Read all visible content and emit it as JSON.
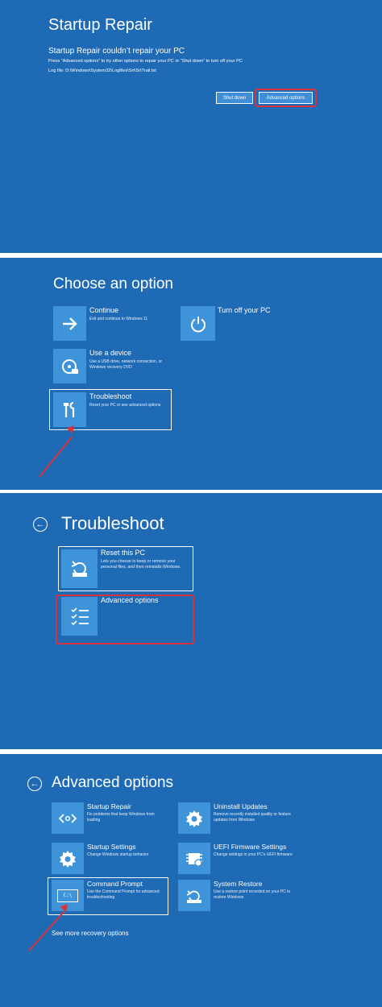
{
  "colors": {
    "background": "#1f6ab5",
    "tile": "#3f93d9",
    "highlight": "#d6343c",
    "separator": "#ffffff"
  },
  "screen1": {
    "title": "Startup Repair",
    "heading": "Startup Repair couldn’t repair your PC",
    "description": "Press “Advanced options” to try other options to repair your PC or “Shut down” to turn off your PC",
    "log_file": "Log file: D:\\Windows\\System32\\Logfiles\\Srt\\SrtTrail.txt",
    "shutdown_label": "Shut down",
    "advanced_label": "Advanced options"
  },
  "screen2": {
    "title": "Choose an option",
    "options": [
      {
        "label": "Continue",
        "desc": "Exit and continue to Windows 11",
        "icon": "arrow-right-icon"
      },
      {
        "label": "Turn off your PC",
        "desc": "",
        "icon": "power-icon"
      },
      {
        "label": "Use a device",
        "desc": "Use a USB drive, network connection, or Windows recovery DVD",
        "icon": "disc-icon"
      },
      {
        "label": "Troubleshoot",
        "desc": "Reset your PC or see advanced options",
        "icon": "tools-icon"
      }
    ]
  },
  "screen3": {
    "title": "Troubleshoot",
    "options": [
      {
        "label": "Reset this PC",
        "desc": "Lets you choose to keep or remove your personal files, and then reinstalls Windows.",
        "icon": "reset-icon"
      },
      {
        "label": "Advanced options",
        "desc": "",
        "icon": "checklist-icon"
      }
    ]
  },
  "screen4": {
    "title": "Advanced options",
    "options": [
      {
        "label": "Startup Repair",
        "desc": "Fix problems that keep Windows from loading",
        "icon": "code-icon"
      },
      {
        "label": "Uninstall Updates",
        "desc": "Remove recently installed quality or feature updates from Windows",
        "icon": "gear-icon"
      },
      {
        "label": "Startup Settings",
        "desc": "Change Windows startup behavior",
        "icon": "gear-icon"
      },
      {
        "label": "UEFI Firmware Settings",
        "desc": "Change settings in your PC’s UEFI firmware",
        "icon": "chip-icon"
      },
      {
        "label": "Command Prompt",
        "desc": "Use the Command Prompt for advanced troubleshooting",
        "icon": "command-prompt-icon",
        "icon_text": "C:\\"
      },
      {
        "label": "System Restore",
        "desc": "Use a restore point recorded on your PC to restore Windows",
        "icon": "restore-icon"
      }
    ],
    "more_link": "See more recovery options"
  }
}
